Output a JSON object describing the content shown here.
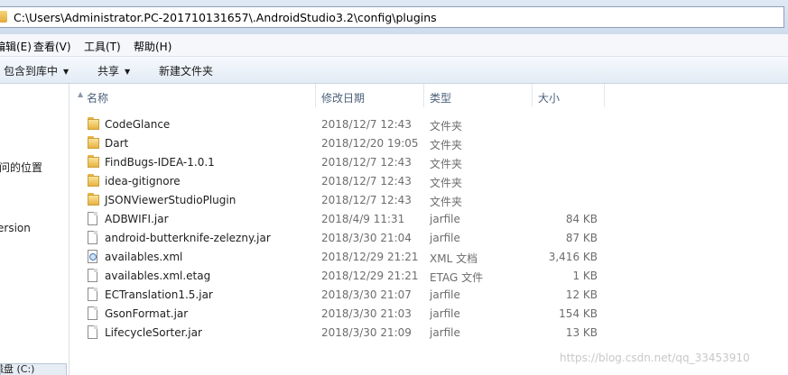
{
  "address": {
    "path": "C:\\Users\\Administrator.PC-201710131657\\.AndroidStudio3.2\\config\\plugins"
  },
  "menu": {
    "items": [
      "编辑(E)",
      "查看(V)",
      "工具(T)",
      "帮助(H)"
    ]
  },
  "toolbar": {
    "include_library": "包含到库中",
    "share": "共享",
    "new_folder": "新建文件夹"
  },
  "nav": {
    "recent_places": "访问的位置",
    "version_item": "ersion",
    "drive": "磁盘 (C:)"
  },
  "columns": {
    "name": "名称",
    "date": "修改日期",
    "type": "类型",
    "size": "大小"
  },
  "files": [
    {
      "name": "CodeGlance",
      "date": "2018/12/7 12:43",
      "type": "文件夹",
      "size": "",
      "icon": "folder-icon"
    },
    {
      "name": "Dart",
      "date": "2018/12/20 19:05",
      "type": "文件夹",
      "size": "",
      "icon": "folder-icon"
    },
    {
      "name": "FindBugs-IDEA-1.0.1",
      "date": "2018/12/7 12:43",
      "type": "文件夹",
      "size": "",
      "icon": "folder-icon"
    },
    {
      "name": "idea-gitignore",
      "date": "2018/12/7 12:43",
      "type": "文件夹",
      "size": "",
      "icon": "folder-icon"
    },
    {
      "name": "JSONViewerStudioPlugin",
      "date": "2018/12/7 12:43",
      "type": "文件夹",
      "size": "",
      "icon": "folder-icon"
    },
    {
      "name": "ADBWIFI.jar",
      "date": "2018/4/9 11:31",
      "type": "jarfile",
      "size": "84 KB",
      "icon": "file-icon"
    },
    {
      "name": "android-butterknife-zelezny.jar",
      "date": "2018/3/30 21:04",
      "type": "jarfile",
      "size": "87 KB",
      "icon": "file-icon"
    },
    {
      "name": "availables.xml",
      "date": "2018/12/29 21:21",
      "type": "XML 文档",
      "size": "3,416 KB",
      "icon": "xml-icon"
    },
    {
      "name": "availables.xml.etag",
      "date": "2018/12/29 21:21",
      "type": "ETAG 文件",
      "size": "1 KB",
      "icon": "file-icon"
    },
    {
      "name": "ECTranslation1.5.jar",
      "date": "2018/3/30 21:07",
      "type": "jarfile",
      "size": "12 KB",
      "icon": "file-icon"
    },
    {
      "name": "GsonFormat.jar",
      "date": "2018/3/30 21:03",
      "type": "jarfile",
      "size": "154 KB",
      "icon": "file-icon"
    },
    {
      "name": "LifecycleSorter.jar",
      "date": "2018/3/30 21:09",
      "type": "jarfile",
      "size": "13 KB",
      "icon": "file-icon"
    }
  ],
  "watermark": "https://blog.csdn.net/qq_33453910"
}
